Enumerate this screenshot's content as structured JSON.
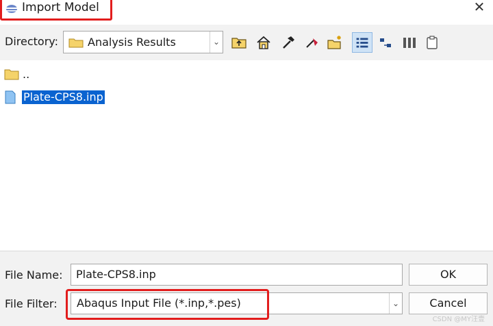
{
  "window": {
    "title": "Import Model",
    "close_glyph": "✕",
    "accent_highlight": "#e21d1d"
  },
  "toolbar": {
    "directory_label": "Directory:",
    "directory_value": "Analysis Results",
    "icons": [
      "folder-up-icon",
      "home-icon",
      "hammer-icon",
      "paint-icon",
      "new-folder-icon",
      "list-view-icon",
      "details-view-icon",
      "columns-icon",
      "clipboard-icon"
    ]
  },
  "file_list": {
    "entries": [
      {
        "name": "..",
        "type": "folder",
        "selected": false
      },
      {
        "name": "Plate-CPS8.inp",
        "type": "file",
        "selected": true
      }
    ]
  },
  "form": {
    "file_name_label": "File Name:",
    "file_name_value": "Plate-CPS8.inp",
    "file_filter_label": "File Filter:",
    "file_filter_value": "Abaqus Input File (*.inp,*.pes)",
    "ok_label": "OK",
    "cancel_label": "Cancel"
  },
  "watermark": "CSDN @MY汪壹"
}
